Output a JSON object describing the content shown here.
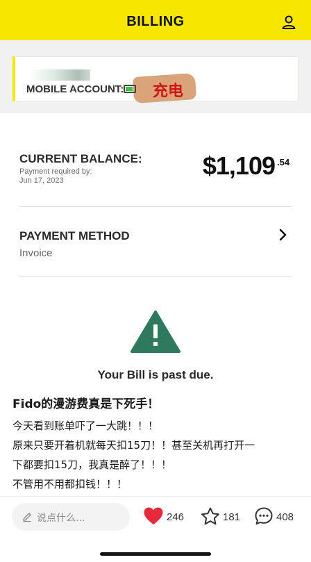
{
  "header": {
    "title": "BILLING",
    "user_icon": "user-profile-icon",
    "color": "#f7e600"
  },
  "account": {
    "label": "MOBILE ACCOUNT:",
    "sticker_text": "充电",
    "battery_icon": "battery-icon"
  },
  "balance": {
    "title": "CURRENT BALANCE:",
    "required_label": "Payment required by:",
    "due_date": "Jun 17, 2023",
    "amount": "$1,109",
    "cents": ".54"
  },
  "payment_method": {
    "title": "PAYMENT METHOD",
    "value": "Invoice",
    "chevron_icon": "chevron-right-icon"
  },
  "alert": {
    "icon": "warning-icon",
    "color": "#2f7a5e",
    "message": "Your Bill is past due."
  },
  "post": {
    "title": "Fido的漫游费真是下死手！",
    "lines": [
      "今天看到账单吓了一大跳！！！",
      "原来只要开着机就每天扣15刀！！甚至关机再打开一",
      "下都要扣15刀，我真是醉了！！！",
      "不管用不用都扣钱！！！"
    ]
  },
  "footer": {
    "comment_placeholder": "说点什么...",
    "likes": "246",
    "favorites": "181",
    "comments": "408",
    "like_color": "#e8283b"
  }
}
